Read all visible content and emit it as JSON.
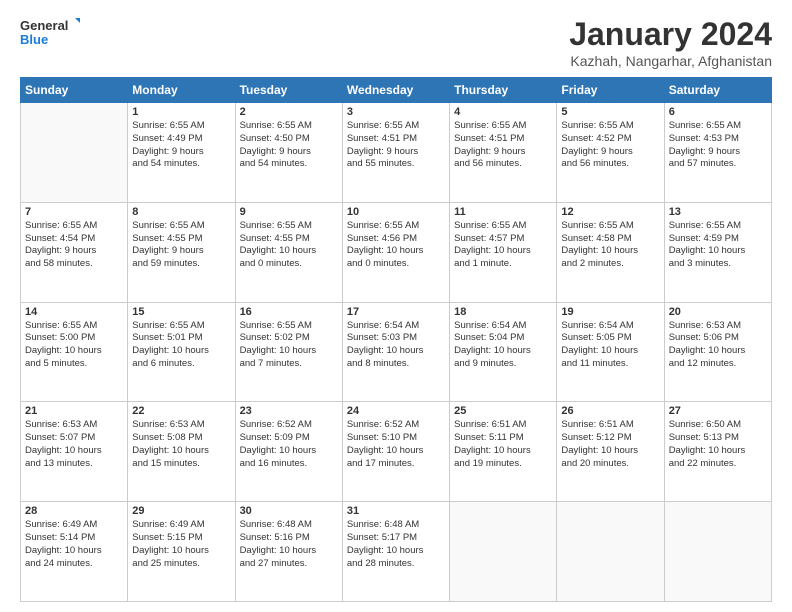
{
  "header": {
    "logo": {
      "general": "General",
      "blue": "Blue"
    },
    "title": "January 2024",
    "location": "Kazhah, Nangarhar, Afghanistan"
  },
  "weekdays": [
    "Sunday",
    "Monday",
    "Tuesday",
    "Wednesday",
    "Thursday",
    "Friday",
    "Saturday"
  ],
  "weeks": [
    [
      {
        "day": "",
        "info": ""
      },
      {
        "day": "1",
        "info": "Sunrise: 6:55 AM\nSunset: 4:49 PM\nDaylight: 9 hours\nand 54 minutes."
      },
      {
        "day": "2",
        "info": "Sunrise: 6:55 AM\nSunset: 4:50 PM\nDaylight: 9 hours\nand 54 minutes."
      },
      {
        "day": "3",
        "info": "Sunrise: 6:55 AM\nSunset: 4:51 PM\nDaylight: 9 hours\nand 55 minutes."
      },
      {
        "day": "4",
        "info": "Sunrise: 6:55 AM\nSunset: 4:51 PM\nDaylight: 9 hours\nand 56 minutes."
      },
      {
        "day": "5",
        "info": "Sunrise: 6:55 AM\nSunset: 4:52 PM\nDaylight: 9 hours\nand 56 minutes."
      },
      {
        "day": "6",
        "info": "Sunrise: 6:55 AM\nSunset: 4:53 PM\nDaylight: 9 hours\nand 57 minutes."
      }
    ],
    [
      {
        "day": "7",
        "info": "Sunrise: 6:55 AM\nSunset: 4:54 PM\nDaylight: 9 hours\nand 58 minutes."
      },
      {
        "day": "8",
        "info": "Sunrise: 6:55 AM\nSunset: 4:55 PM\nDaylight: 9 hours\nand 59 minutes."
      },
      {
        "day": "9",
        "info": "Sunrise: 6:55 AM\nSunset: 4:55 PM\nDaylight: 10 hours\nand 0 minutes."
      },
      {
        "day": "10",
        "info": "Sunrise: 6:55 AM\nSunset: 4:56 PM\nDaylight: 10 hours\nand 0 minutes."
      },
      {
        "day": "11",
        "info": "Sunrise: 6:55 AM\nSunset: 4:57 PM\nDaylight: 10 hours\nand 1 minute."
      },
      {
        "day": "12",
        "info": "Sunrise: 6:55 AM\nSunset: 4:58 PM\nDaylight: 10 hours\nand 2 minutes."
      },
      {
        "day": "13",
        "info": "Sunrise: 6:55 AM\nSunset: 4:59 PM\nDaylight: 10 hours\nand 3 minutes."
      }
    ],
    [
      {
        "day": "14",
        "info": "Sunrise: 6:55 AM\nSunset: 5:00 PM\nDaylight: 10 hours\nand 5 minutes."
      },
      {
        "day": "15",
        "info": "Sunrise: 6:55 AM\nSunset: 5:01 PM\nDaylight: 10 hours\nand 6 minutes."
      },
      {
        "day": "16",
        "info": "Sunrise: 6:55 AM\nSunset: 5:02 PM\nDaylight: 10 hours\nand 7 minutes."
      },
      {
        "day": "17",
        "info": "Sunrise: 6:54 AM\nSunset: 5:03 PM\nDaylight: 10 hours\nand 8 minutes."
      },
      {
        "day": "18",
        "info": "Sunrise: 6:54 AM\nSunset: 5:04 PM\nDaylight: 10 hours\nand 9 minutes."
      },
      {
        "day": "19",
        "info": "Sunrise: 6:54 AM\nSunset: 5:05 PM\nDaylight: 10 hours\nand 11 minutes."
      },
      {
        "day": "20",
        "info": "Sunrise: 6:53 AM\nSunset: 5:06 PM\nDaylight: 10 hours\nand 12 minutes."
      }
    ],
    [
      {
        "day": "21",
        "info": "Sunrise: 6:53 AM\nSunset: 5:07 PM\nDaylight: 10 hours\nand 13 minutes."
      },
      {
        "day": "22",
        "info": "Sunrise: 6:53 AM\nSunset: 5:08 PM\nDaylight: 10 hours\nand 15 minutes."
      },
      {
        "day": "23",
        "info": "Sunrise: 6:52 AM\nSunset: 5:09 PM\nDaylight: 10 hours\nand 16 minutes."
      },
      {
        "day": "24",
        "info": "Sunrise: 6:52 AM\nSunset: 5:10 PM\nDaylight: 10 hours\nand 17 minutes."
      },
      {
        "day": "25",
        "info": "Sunrise: 6:51 AM\nSunset: 5:11 PM\nDaylight: 10 hours\nand 19 minutes."
      },
      {
        "day": "26",
        "info": "Sunrise: 6:51 AM\nSunset: 5:12 PM\nDaylight: 10 hours\nand 20 minutes."
      },
      {
        "day": "27",
        "info": "Sunrise: 6:50 AM\nSunset: 5:13 PM\nDaylight: 10 hours\nand 22 minutes."
      }
    ],
    [
      {
        "day": "28",
        "info": "Sunrise: 6:49 AM\nSunset: 5:14 PM\nDaylight: 10 hours\nand 24 minutes."
      },
      {
        "day": "29",
        "info": "Sunrise: 6:49 AM\nSunset: 5:15 PM\nDaylight: 10 hours\nand 25 minutes."
      },
      {
        "day": "30",
        "info": "Sunrise: 6:48 AM\nSunset: 5:16 PM\nDaylight: 10 hours\nand 27 minutes."
      },
      {
        "day": "31",
        "info": "Sunrise: 6:48 AM\nSunset: 5:17 PM\nDaylight: 10 hours\nand 28 minutes."
      },
      {
        "day": "",
        "info": ""
      },
      {
        "day": "",
        "info": ""
      },
      {
        "day": "",
        "info": ""
      }
    ]
  ]
}
